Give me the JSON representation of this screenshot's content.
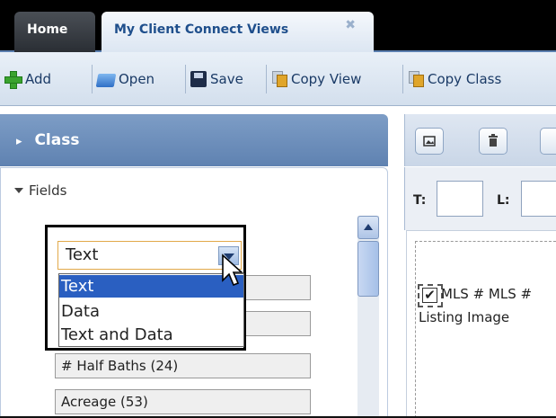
{
  "tabs": [
    {
      "label": "Home",
      "active": false
    },
    {
      "label": "My Client Connect Views",
      "active": true,
      "close_glyph": "✖"
    }
  ],
  "toolbar": {
    "add_label": "Add",
    "open_label": "Open",
    "save_label": "Save",
    "copy_view_label": "Copy View",
    "copy_class_label": "Copy Class"
  },
  "left_panel": {
    "class_header": "Class",
    "class_arrow": "▸",
    "fields_label": "Fields"
  },
  "dropdown": {
    "selected_value": "Text",
    "options": [
      "Text",
      "Data",
      "Text and Data"
    ],
    "highlighted_index": 0
  },
  "fields": [
    {
      "label": "# Half Baths (24)"
    },
    {
      "label": "Acreage (53)"
    }
  ],
  "right_panel": {
    "t_label": "T:",
    "l_label": "L:",
    "mls_text": "MLS #  MLS #",
    "listing_image_label": "Listing Image",
    "checkbox_glyph": "✔"
  },
  "colors": {
    "tab_strip": "#000000",
    "active_tab_text": "#1f4f8c",
    "class_header": "#6a8bb8",
    "selection": "#2a5fc1"
  }
}
